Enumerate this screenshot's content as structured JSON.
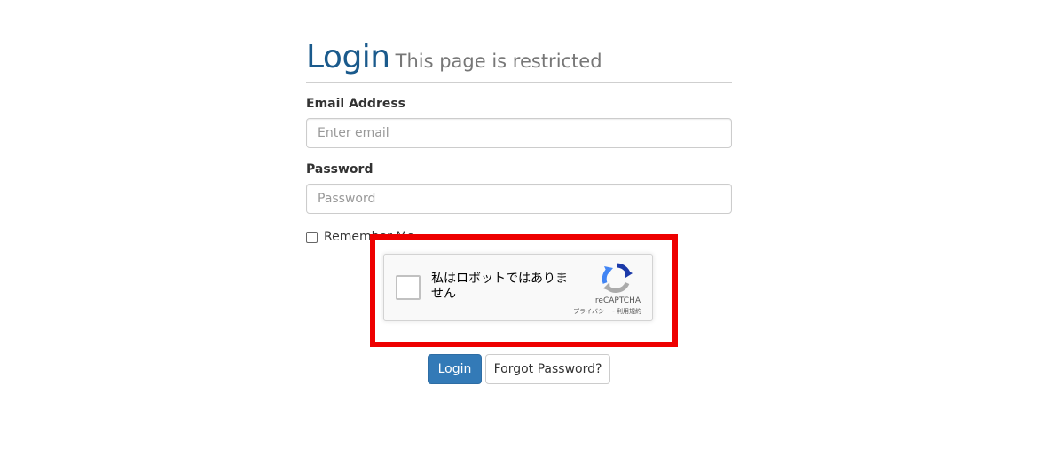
{
  "header": {
    "title": "Login",
    "subtitle": "This page is restricted"
  },
  "form": {
    "email_label": "Email Address",
    "email_placeholder": "Enter email",
    "email_value": "",
    "password_label": "Password",
    "password_placeholder": "Password",
    "password_value": "",
    "remember_label": "Remember Me",
    "remember_checked": false
  },
  "recaptcha": {
    "label": "私はロボットではありません",
    "brand": "reCAPTCHA",
    "links": "プライバシー - 利用規約",
    "checked": false
  },
  "buttons": {
    "login_label": "Login",
    "forgot_label": "Forgot Password?"
  },
  "colors": {
    "title": "#1a5a8c",
    "primary_button": "#337ab7",
    "highlight": "#ee0000"
  }
}
